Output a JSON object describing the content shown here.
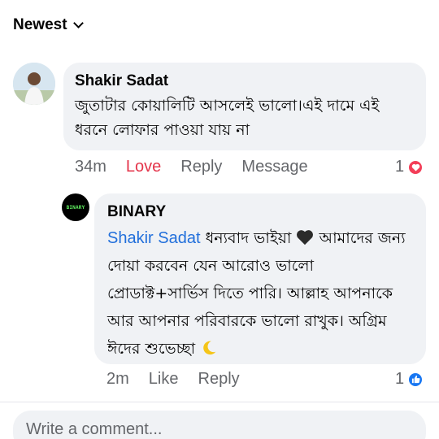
{
  "sort": {
    "label": "Newest"
  },
  "comments": [
    {
      "author": "Shakir Sadat",
      "text": "জুতাটার কোয়ালিটি আসলেই ভালো।এই দামে এই ধরনে লোফার পাওয়া যায় না",
      "time": "34m",
      "reaction_label": "Love",
      "reply_label": "Reply",
      "message_label": "Message",
      "reaction_count": "1",
      "reaction_icon": "love-reaction-icon"
    },
    {
      "author": "BINARY",
      "avatar_text": "BINARY",
      "mention": "Shakir Sadat",
      "text_intro": "ধন্যবাদ ভাইয়া",
      "text_body": "আমাদের জন্য দোয়া করবেন যেন আরোও ভালো প্রোডাক্ট+সার্ভিস দিতে পারি। আল্লাহ আপনাকে আর আপনার পরিবারকে ভালো রাখুক। অগ্রিম ঈদের শুভেচ্ছা",
      "time": "2m",
      "like_label": "Like",
      "reply_label": "Reply",
      "reaction_count": "1",
      "reaction_icon": "like-reaction-icon"
    }
  ],
  "composer": {
    "placeholder": "Write a comment..."
  },
  "colors": {
    "love": "#e4354b",
    "mention": "#216fdb",
    "like": "#1877f2",
    "bubble": "#f0f2f5"
  }
}
